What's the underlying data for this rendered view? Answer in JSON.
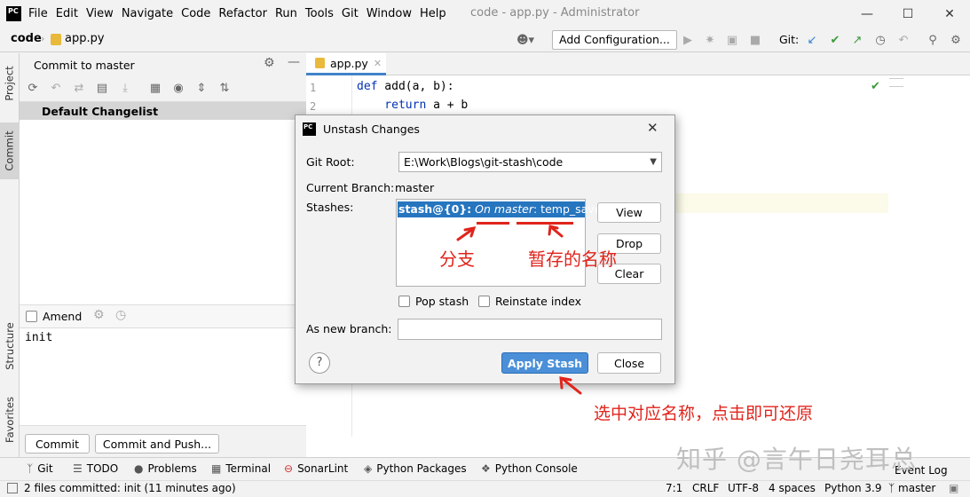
{
  "titlebar": {
    "logo_text": "PC",
    "menu": [
      "File",
      "Edit",
      "View",
      "Navigate",
      "Code",
      "Refactor",
      "Run",
      "Tools",
      "Git",
      "Window",
      "Help"
    ],
    "window_title": "code - app.py - Administrator"
  },
  "navbar": {
    "project": "code",
    "file": "app.py",
    "add_configuration": "Add Configuration...",
    "git_label": "Git:"
  },
  "sidebar_left": {
    "tabs": [
      "Project",
      "Commit",
      "Structure",
      "Favorites"
    ]
  },
  "commit_panel": {
    "title": "Commit to master",
    "changelist": "Default Changelist",
    "amend_label": "Amend",
    "message": "init",
    "commit_button": "Commit",
    "commit_push_button": "Commit and Push..."
  },
  "editor": {
    "tab_label": "app.py",
    "lines": [
      {
        "num": "1",
        "kw": "def",
        "rest": " add(a, b):"
      },
      {
        "num": "2",
        "kw": "    return",
        "rest": " a + b"
      }
    ]
  },
  "dialog": {
    "title": "Unstash Changes",
    "git_root_label": "Git Root:",
    "git_root_value": "E:\\Work\\Blogs\\git-stash\\code",
    "current_branch_label": "Current Branch:",
    "current_branch_value": "master",
    "stashes_label": "Stashes:",
    "stash_ref": "stash@{0}:",
    "stash_branch": "On master",
    "stash_name": ": temp_save",
    "view_button": "View",
    "drop_button": "Drop",
    "clear_button": "Clear",
    "pop_stash_label": "Pop stash",
    "reinstate_label": "Reinstate index",
    "new_branch_label": "As new branch:",
    "help_glyph": "?",
    "apply_button": "Apply Stash",
    "close_button": "Close"
  },
  "annotations": {
    "branch_note": "分支",
    "name_note": "暂存的名称",
    "apply_note": "选中对应名称，点击即可还原"
  },
  "statusstrip": {
    "items": [
      "Git",
      "TODO",
      "Problems",
      "Terminal",
      "SonarLint",
      "Python Packages",
      "Python Console"
    ],
    "event_log": "Event Log"
  },
  "statusbar": {
    "message": "2 files committed: init (11 minutes ago)",
    "position": "7:1",
    "line_sep": "CRLF",
    "encoding": "UTF-8",
    "indent": "4 spaces",
    "interpreter": "Python 3.9",
    "branch": "master"
  },
  "watermark": "知乎 @言午日尧耳总",
  "colors": {
    "selection": "#2675bf",
    "annotation_red": "#e0241c",
    "apply_button": "#4a8fd8",
    "keyword": "#0033b3"
  }
}
